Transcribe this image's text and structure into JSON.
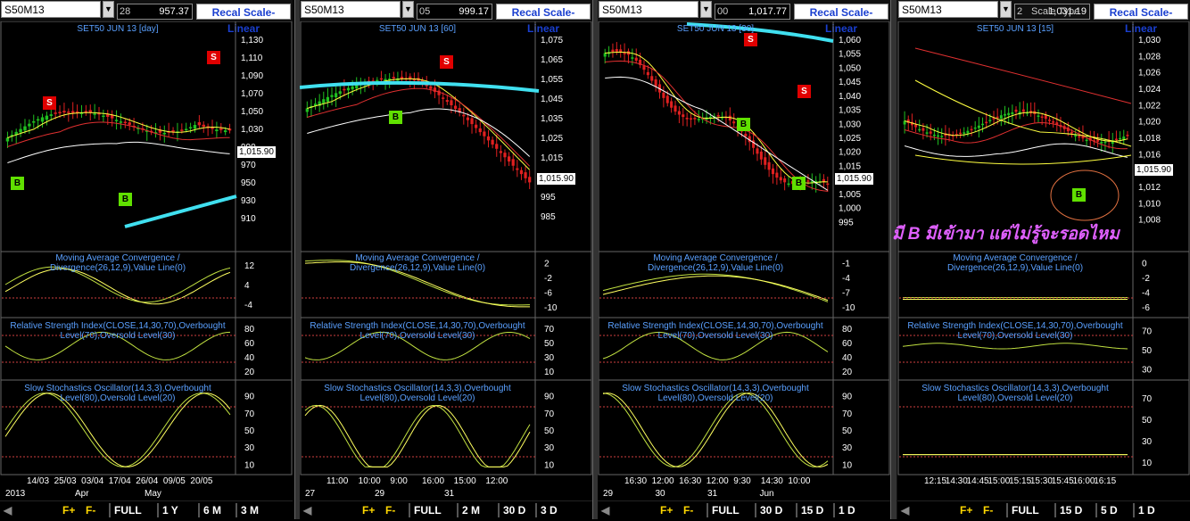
{
  "panels": [
    {
      "symbol": "S50M13",
      "range_left": "28",
      "range_value": "957.37",
      "recal_label": "Recal Scale-Linear",
      "title": "SET50 JUN 13  [day]",
      "current_price": "1,015.90",
      "price_ticks": [
        "1,130",
        "1,110",
        "1,090",
        "1,070",
        "1,050",
        "1,030",
        "990",
        "970",
        "950",
        "930",
        "910"
      ],
      "macd_title": "Moving Average Convergence / Divergence(26,12,9),Value Line(0)",
      "macd_ticks": [
        "12",
        "4",
        "-4"
      ],
      "rsi_title": "Relative Strength Index(CLOSE,14,30,70),Overbought Level(70),Oversold Level(30)",
      "rsi_ticks": [
        "80",
        "60",
        "40",
        "20"
      ],
      "sto_title": "Slow Stochastics Oscillator(14,3,3),Overbought Level(80),Oversold Level(20)",
      "sto_ticks": [
        "90",
        "70",
        "50",
        "30",
        "10"
      ],
      "date_ticks": [
        "14/03",
        "25/03",
        "03/04",
        "17/04",
        "26/04",
        "09/05",
        "20/05"
      ],
      "date_labels": [
        "2013",
        "Apr",
        "May"
      ],
      "bottom_buttons": [
        "FULL",
        "1 Y",
        "6 M",
        "3 M"
      ],
      "signals": [
        "S",
        "B",
        "B",
        "S"
      ]
    },
    {
      "symbol": "S50M13",
      "range_left": "05",
      "range_value": "999.17",
      "recal_label": "Recal Scale-Linear",
      "title": "SET50 JUN 13  [60]",
      "current_price": "1,015.90",
      "price_ticks": [
        "1,075",
        "1,065",
        "1,055",
        "1,045",
        "1,035",
        "1,025",
        "1,015",
        "1,005",
        "995",
        "985"
      ],
      "macd_title": "Moving Average Convergence / Divergence(26,12,9),Value Line(0)",
      "macd_ticks": [
        "2",
        "-2",
        "-6",
        "-10"
      ],
      "rsi_title": "Relative Strength Index(CLOSE,14,30,70),Overbought Level(70),Oversold Level(30)",
      "rsi_ticks": [
        "70",
        "50",
        "30",
        "10"
      ],
      "sto_title": "Slow Stochastics Oscillator(14,3,3),Overbought Level(80),Oversold Level(20)",
      "sto_ticks": [
        "90",
        "70",
        "50",
        "30",
        "10"
      ],
      "date_ticks": [
        "11:00",
        "10:00",
        "9:00",
        "16:00",
        "15:00",
        "12:00"
      ],
      "date_labels": [
        "27",
        "29",
        "31"
      ],
      "bottom_buttons": [
        "FULL",
        "2 M",
        "30 D",
        "3 D"
      ],
      "signals": [
        "B",
        "S"
      ]
    },
    {
      "symbol": "S50M13",
      "range_left": "00",
      "range_value": "1,017.77",
      "recal_label": "Recal Scale-Linear",
      "title": "SET50 JUN 13  [30]",
      "current_price": "1,015.90",
      "price_ticks": [
        "1,060",
        "1,055",
        "1,050",
        "1,045",
        "1,040",
        "1,035",
        "1,030",
        "1,025",
        "1,020",
        "1,015",
        "1,010",
        "1,005",
        "1,000",
        "995"
      ],
      "macd_title": "Moving Average Convergence / Divergence(26,12,9),Value Line(0)",
      "macd_ticks": [
        "-1",
        "-4",
        "-7",
        "-10"
      ],
      "rsi_title": "Relative Strength Index(CLOSE,14,30,70),Overbought Level(70),Oversold Level(30)",
      "rsi_ticks": [
        "80",
        "60",
        "40",
        "20"
      ],
      "sto_title": "Slow Stochastics Oscillator(14,3,3),Overbought Level(80),Oversold Level(20)",
      "sto_ticks": [
        "90",
        "70",
        "50",
        "30",
        "10"
      ],
      "date_ticks": [
        "16:30",
        "12:00",
        "16:30",
        "12:00",
        "9:30",
        "14:30",
        "10:00"
      ],
      "date_labels": [
        "29",
        "30",
        "31",
        "Jun"
      ],
      "bottom_buttons": [
        "FULL",
        "30 D",
        "15 D",
        "1 D"
      ],
      "signals": [
        "S",
        "B",
        "S",
        "B"
      ]
    },
    {
      "symbol": "S50M13",
      "range_left": "2",
      "scale_type": "Scale Type",
      "range_value": "1,031.19",
      "recal_label": "Recal Scale-Linear",
      "title": "SET50 JUN 13  [15]",
      "current_price": "1,015.90",
      "price_ticks": [
        "1,030",
        "1,028",
        "1,026",
        "1,024",
        "1,022",
        "1,020",
        "1,018",
        "1,016",
        "1,014",
        "1,012",
        "1,010",
        "1,008"
      ],
      "macd_title": "Moving Average Convergence / Divergence(26,12,9),Value Line(0)",
      "macd_ticks": [
        "0",
        "-2",
        "-4",
        "-6"
      ],
      "rsi_title": "Relative Strength Index(CLOSE,14,30,70),Overbought Level(70),Oversold Level(30)",
      "rsi_ticks": [
        "70",
        "50",
        "30"
      ],
      "sto_title": "Slow Stochastics Oscillator(14,3,3),Overbought Level(80),Oversold Level(20)",
      "sto_ticks": [
        "70",
        "50",
        "30",
        "10"
      ],
      "date_ticks": [
        "12:15",
        "14:30",
        "14:45",
        "15:00",
        "15:15",
        "15:30",
        "15:45",
        "16:00",
        "16:15"
      ],
      "date_labels": [],
      "bottom_buttons": [
        "FULL",
        "15 D",
        "5 D",
        "1 D"
      ],
      "signals": [
        "B"
      ],
      "annotation": "มี B มีเข้ามา แต่ไม่รู้จะรอดไหม"
    }
  ],
  "fplus_label": "F+",
  "fminus_label": "F-",
  "colors": {
    "candle_up": "#20c020",
    "candle_down": "#e02020",
    "ma_fast": "#ffff40",
    "ma_mid": "#e03030",
    "ma_slow": "#ffffff",
    "ma_long": "#40e0f0",
    "caption": "#5aa0ff",
    "annotation": "#e060ff"
  }
}
